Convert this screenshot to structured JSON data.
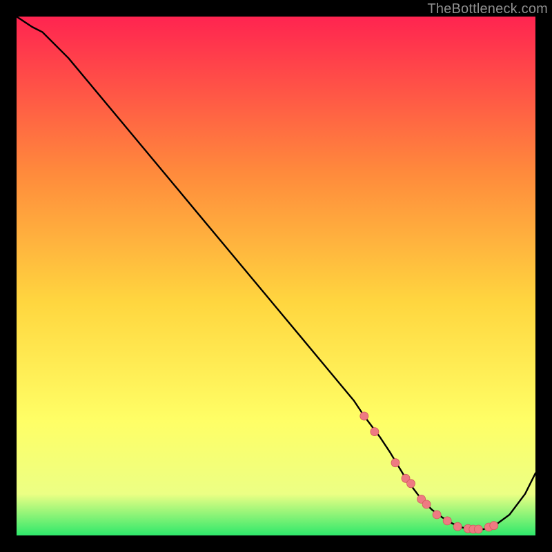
{
  "watermark": "TheBottleneck.com",
  "colors": {
    "bg": "#000000",
    "curve": "#000000",
    "marker_fill": "#ee7a82",
    "marker_stroke": "#d05b5b",
    "grad_top": "#ff2450",
    "grad_mid1": "#ff8a3c",
    "grad_mid2": "#ffd63f",
    "grad_mid3": "#ffff66",
    "grad_mid4": "#ecff84",
    "grad_bottom": "#2ee86b"
  },
  "chart_data": {
    "type": "line",
    "title": "",
    "xlabel": "",
    "ylabel": "",
    "xlim": [
      0,
      100
    ],
    "ylim": [
      0,
      100
    ],
    "series": [
      {
        "name": "score-curve",
        "x": [
          0,
          3,
          5,
          10,
          15,
          20,
          25,
          30,
          35,
          40,
          45,
          50,
          55,
          60,
          65,
          67,
          70,
          72,
          75,
          78,
          80,
          82,
          84,
          86,
          88,
          90,
          92,
          95,
          98,
          100
        ],
        "y": [
          100,
          98,
          97,
          92,
          86,
          80,
          74,
          68,
          62,
          56,
          50,
          44,
          38,
          32,
          26,
          23,
          19,
          16,
          11,
          7,
          5,
          3.5,
          2.3,
          1.5,
          1.2,
          1.2,
          1.8,
          4,
          8,
          12
        ]
      }
    ],
    "markers": {
      "name": "highlight-points",
      "x": [
        67,
        69,
        73,
        75,
        76,
        78,
        79,
        81,
        83,
        85,
        87,
        88,
        89,
        91,
        92
      ],
      "y": [
        23,
        20,
        14,
        11,
        10,
        7,
        6,
        4,
        2.8,
        1.7,
        1.3,
        1.2,
        1.2,
        1.6,
        1.9
      ]
    }
  }
}
